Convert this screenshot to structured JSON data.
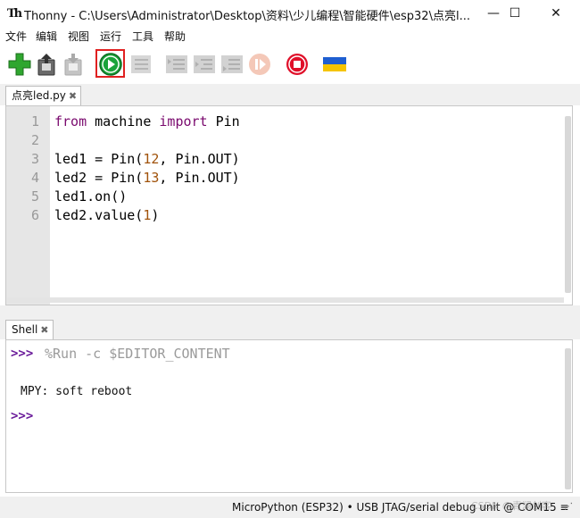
{
  "window": {
    "app_glyph": "Th",
    "title": "Thonny  -  C:\\Users\\Administrator\\Desktop\\资料\\少儿编程\\智能硬件\\esp32\\点亮l...",
    "minimize": "—",
    "maximize": "☐",
    "close": "✕"
  },
  "menu": [
    "文件",
    "编辑",
    "视图",
    "运行",
    "工具",
    "帮助"
  ],
  "toolbar": {
    "icons": [
      "new-file-icon",
      "open-file-icon",
      "save-file-icon",
      "run-icon",
      "debug-icon",
      "step-over-icon",
      "step-into-icon",
      "step-out-icon",
      "resume-icon",
      "stop-icon",
      "ukraine-flag-icon"
    ],
    "highlighted": "run-icon"
  },
  "editor": {
    "tab_name": "点亮led.py",
    "tab_close": "✖",
    "line_numbers": [
      "1",
      "2",
      "3",
      "4",
      "5",
      "6"
    ],
    "lines": [
      {
        "kw1": "from",
        "text1": " machine ",
        "kw2": "import",
        "text2": " Pin"
      },
      {
        "text": ""
      },
      {
        "pre": "led1 = Pin(",
        "num": "12",
        "post": ", Pin.OUT)"
      },
      {
        "pre": "led2 = Pin(",
        "num": "13",
        "post": ", Pin.OUT)"
      },
      {
        "text": "led1.on()"
      },
      {
        "pre": "led2.value(",
        "num": "1",
        "post": ")"
      }
    ]
  },
  "shell": {
    "tab_name": "Shell",
    "tab_close": "✖",
    "prompt": ">>>",
    "command": "%Run -c $EDITOR_CONTENT",
    "output": "MPY: soft reboot",
    "prompt2": ">>>"
  },
  "status": {
    "interpreter": "MicroPython (ESP32)  •  USB JTAG/serial debug unit @ COM15 ≡",
    "watermark": "CSDN @青澜创客"
  },
  "colors": {
    "keyword": "#7a0a6e",
    "number": "#a0520a",
    "prompt": "#6a1b9a",
    "run_green": "#1aa33a",
    "stop_red": "#e0102a",
    "highlight_border": "#e02020"
  }
}
